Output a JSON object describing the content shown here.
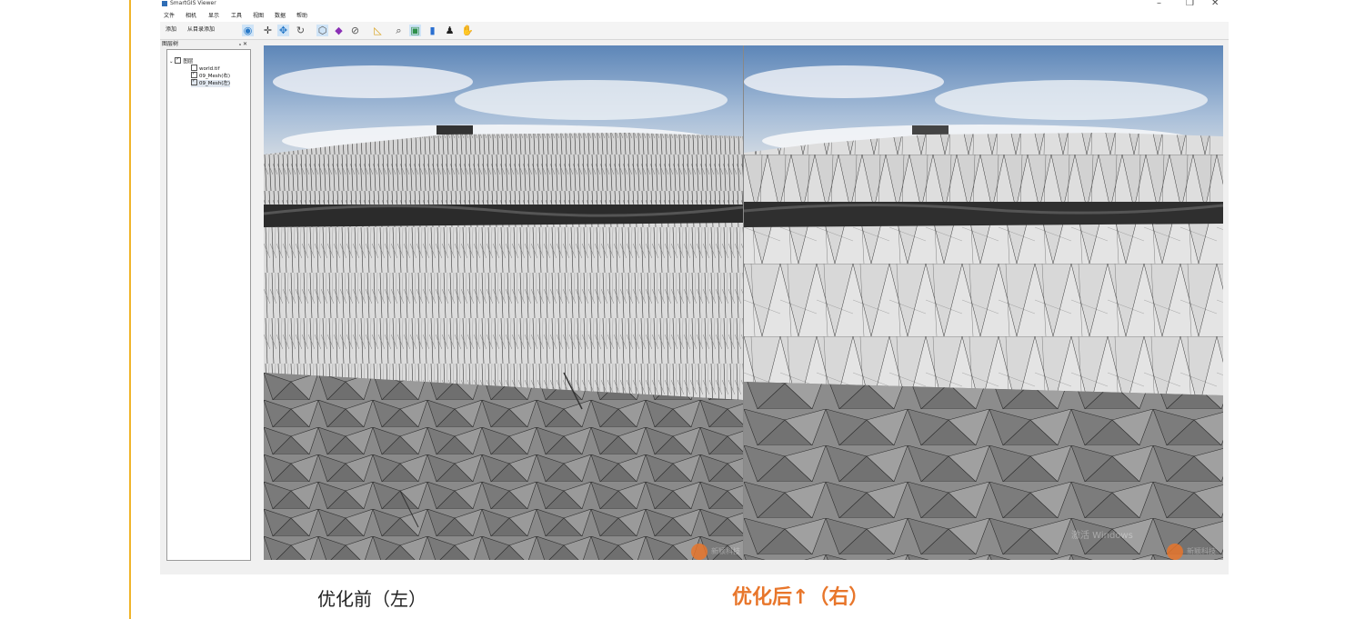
{
  "app": {
    "title": "SmartGIS Viewer",
    "window_controls": {
      "minimize": "–",
      "restore": "❐",
      "close": "✕"
    }
  },
  "menu": [
    "文件",
    "相机",
    "显示",
    "工具",
    "视图",
    "数据",
    "帮助"
  ],
  "toolbar": {
    "add_label": "添加",
    "add_from_dir_label": "从目录添加",
    "icons": [
      "eye-icon",
      "pan-icon",
      "navigate-icon",
      "rotate-icon",
      "box-icon",
      "cube-icon",
      "hide-icon",
      "measure-icon",
      "zoom-icon",
      "image-icon",
      "book-icon",
      "person-icon",
      "hand-icon"
    ]
  },
  "layer_panel": {
    "title": "图层树",
    "buttons": "ₐ ✕",
    "root_label": "图层",
    "items": [
      {
        "label": "world.tif",
        "checked": false
      },
      {
        "label": "09_Mesh(右)",
        "checked": true
      },
      {
        "label": "09_Mesh(左)",
        "checked": true
      }
    ]
  },
  "viewport": {
    "watermark_left": "新颖科技",
    "watermark_right": "新颖科技",
    "activate_windows": "激活 Windows"
  },
  "captions": {
    "left": "优化前（左）",
    "right": "优化后↑（右）"
  },
  "colors": {
    "accent": "#e8762b",
    "side_line": "#f0b429"
  }
}
